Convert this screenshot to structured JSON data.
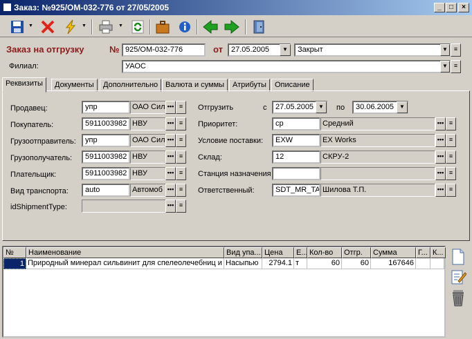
{
  "window": {
    "title": "Заказ: №925/ОМ-032-776 от 27/05/2005"
  },
  "header": {
    "order_label": "Заказ на отгрузку",
    "number_sign": "№",
    "number": "925/ОМ-032-776",
    "from_label": "от",
    "date": "27.05.2005",
    "status": "Закрыт",
    "branch_label": "Филиал:",
    "branch": "УАОС"
  },
  "tabs": [
    "Реквизиты",
    "Документы",
    "Дополнительно",
    "Валюта и суммы",
    "Атрибуты",
    "Описание"
  ],
  "left_fields": [
    {
      "label": "Продавец:",
      "code": "упр",
      "name": "ОАО Сил"
    },
    {
      "label": "Покупатель:",
      "code": "5911003982",
      "name": "НВУ"
    },
    {
      "label": "Грузоотправитель:",
      "code": "упр",
      "name": "ОАО Сил"
    },
    {
      "label": "Грузополучатель:",
      "code": "5911003982",
      "name": "НВУ"
    },
    {
      "label": "Плательщик:",
      "code": "5911003982",
      "name": "НВУ"
    },
    {
      "label": "Вид транспорта:",
      "code": "auto",
      "name": "Автомоб"
    },
    {
      "label": "idShipmentType:",
      "code": "",
      "name": ""
    }
  ],
  "ship": {
    "label": "Отгрузить",
    "from_label": "с",
    "from": "27.05.2005",
    "to_label": "по",
    "to": "30.06.2005"
  },
  "right_fields": [
    {
      "label": "Приоритет:",
      "code": "ср",
      "name": "Средний"
    },
    {
      "label": "Условие поставки:",
      "code": "EXW",
      "name": "EX Works"
    },
    {
      "label": "Склад:",
      "code": "12",
      "name": "СКРУ-2"
    },
    {
      "label": "Станция назначения",
      "code": "",
      "name": ""
    },
    {
      "label": "Ответственный:",
      "code": "SDT_MR_TA",
      "name": "Шилова Т.П."
    }
  ],
  "table": {
    "columns": [
      "№",
      "Наименование",
      "Вид упа...",
      "Цена",
      "Е...",
      "Кол-во",
      "Отгр.",
      "Сумма",
      "Г...",
      "К..."
    ],
    "rows": [
      [
        "1",
        "Природный минерал сильвинит для спелеолечебниц и",
        "Насыпью",
        "2794.1",
        "т",
        "60",
        "60",
        "167646",
        "",
        ""
      ]
    ]
  },
  "buttons": {
    "ellipsis": "•••",
    "menu": "≡",
    "dropdown": "▼"
  }
}
